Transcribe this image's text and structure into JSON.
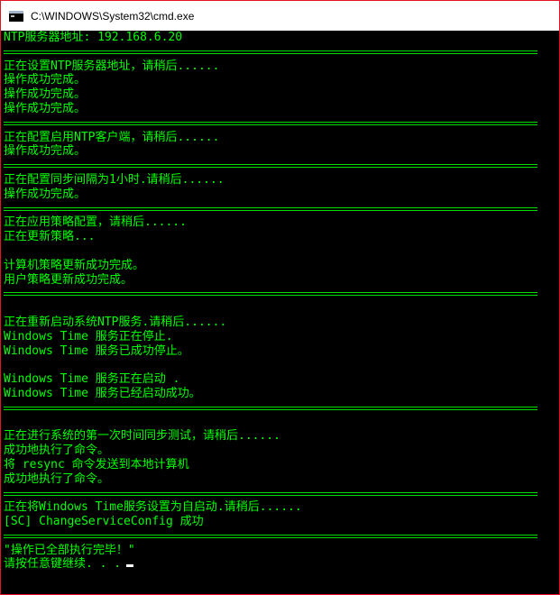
{
  "window": {
    "title": "C:\\WINDOWS\\System32\\cmd.exe",
    "icon": "cmd-icon"
  },
  "console": {
    "text_color": "#00ff00",
    "background": "#000000",
    "lines": [
      "NTP服务器地址: 192.168.6.20",
      "",
      "正在设置NTP服务器地址，请稍后......",
      "操作成功完成。",
      "操作成功完成。",
      "操作成功完成。",
      "",
      "正在配置启用NTP客户端，请稍后......",
      "操作成功完成。",
      "",
      "正在配置同步间隔为1小时.请稍后......",
      "操作成功完成。",
      "",
      "正在应用策略配置，请稍后......",
      "正在更新策略...",
      "",
      "计算机策略更新成功完成。",
      "用户策略更新成功完成。",
      "",
      "",
      "正在重新启动系统NTP服务.请稍后......",
      "Windows Time 服务正在停止.",
      "Windows Time 服务已成功停止。",
      "",
      "Windows Time 服务正在启动 .",
      "Windows Time 服务已经启动成功。",
      "",
      "",
      "正在进行系统的第一次时间同步测试，请稍后......",
      "成功地执行了命令。",
      "将 resync 命令发送到本地计算机",
      "成功地执行了命令。",
      "",
      "正在将Windows Time服务设置为自启动.请稍后......",
      "[SC] ChangeServiceConfig 成功",
      "",
      "\"操作已全部执行完毕！\"",
      "请按任意键继续. . ."
    ],
    "separator_lines": [
      1,
      6,
      9,
      12,
      18,
      26,
      32,
      35
    ]
  }
}
